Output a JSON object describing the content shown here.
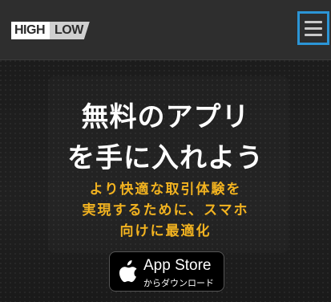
{
  "header": {
    "logo_high": "HIGH",
    "logo_low": "LOW",
    "menu_icon": "hamburger-menu-icon",
    "accent_color": "#2b95d6"
  },
  "hero": {
    "headline_line1": "無料のアプリ",
    "headline_line2": "を手に入れよう",
    "sub_line1": "より快適な取引体験を",
    "sub_line2": "実現するために、スマホ",
    "sub_line3": "向けに最適化",
    "sub_color": "#f2b320"
  },
  "app_store_button": {
    "icon": "apple-icon",
    "title": "App Store",
    "subtitle": "からダウンロード"
  }
}
